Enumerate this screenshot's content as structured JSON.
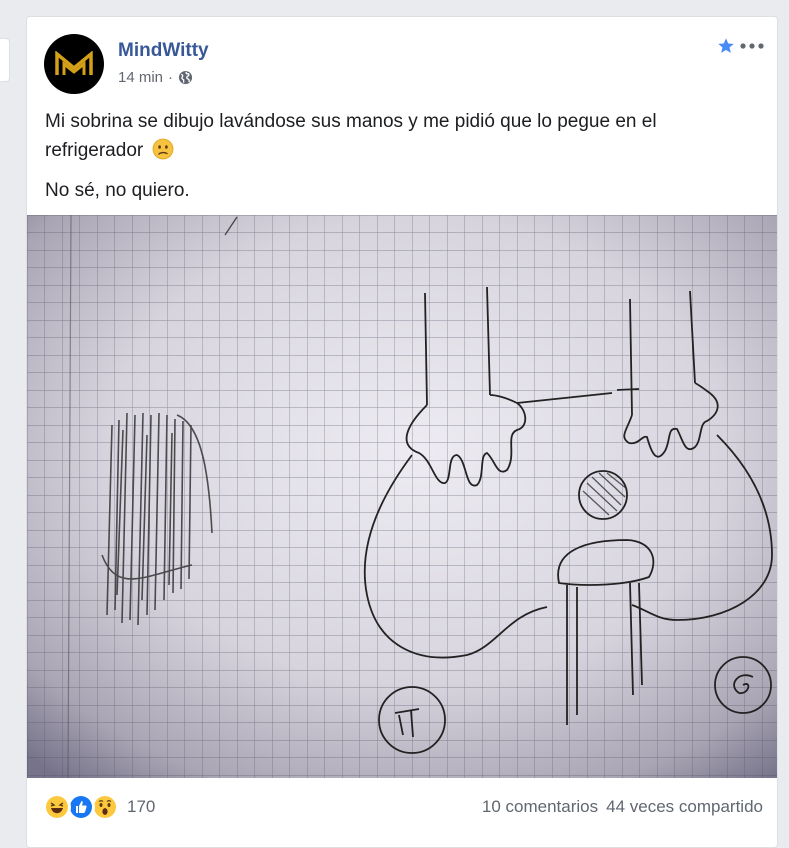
{
  "post": {
    "page_name": "MindWitty",
    "timestamp": "14 min",
    "separator": "·",
    "privacy_icon": "globe-icon",
    "text_line1": "Mi sobrina se dibujo lavándose sus manos y me pidió que lo pegue en el refrigerador",
    "text_emoji": "confused-face-emoji",
    "text_line2": "No sé, no quiero.",
    "photo_icon": "child-drawing-hand-washing"
  },
  "reactions": {
    "types": [
      "haha-icon",
      "like-icon",
      "wow-icon"
    ],
    "count": "170"
  },
  "footer": {
    "comments": "10 comentarios",
    "shares": "44 veces compartido"
  },
  "colors": {
    "page_name": "#385898",
    "like_blue": "#1877f2",
    "haha_yellow": "#fcc93e",
    "star_blue": "#4a8af4"
  }
}
